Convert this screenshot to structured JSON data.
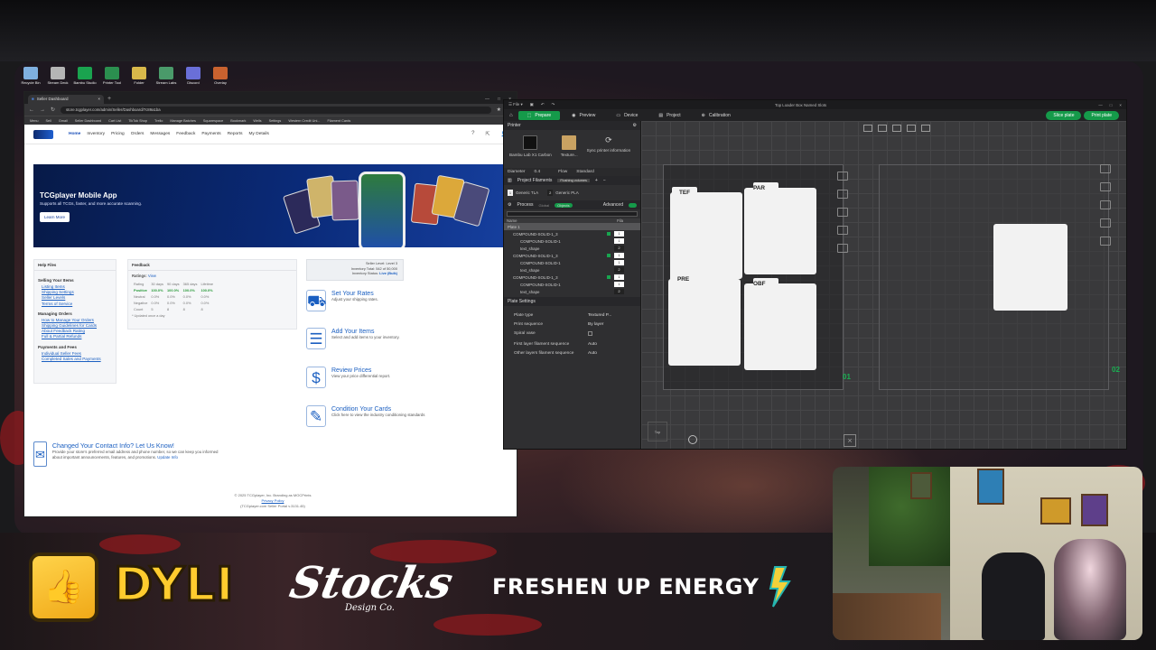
{
  "desktop_icons": [
    "Recycle Bin",
    "Stream Deck",
    "Bambu Studio",
    "Printer Tool",
    "Folder",
    "Stream Labs",
    "Discord",
    "Overlay"
  ],
  "browser": {
    "tab_title": "Seller Dashboard",
    "url": "store.tcgplayer.com/admin/Seller/Dashboard/7c89a1ba",
    "bookmarks": [
      "Menu",
      "Sell",
      "Gmail",
      "Seller Dashboard",
      "Cart List",
      "TikTok Shop",
      "Trello",
      "Manage Batches",
      "Squarespace",
      "Bookmark",
      "Wells",
      "Settings",
      "Western Credit Uni...",
      "Filament Cards"
    ]
  },
  "tcg": {
    "nav": [
      "Home",
      "Inventory",
      "Pricing",
      "Orders",
      "Messages",
      "Feedback",
      "Payments",
      "Reports",
      "My Details"
    ],
    "hero": {
      "title": "TCGplayer Mobile App",
      "subtitle": "Supports all TCGs, faster, and more accurate scanning.",
      "button": "Learn More"
    },
    "help": {
      "title": "Help Files",
      "groups": [
        {
          "header": "Selling Your Items",
          "links": [
            "Listing Items",
            "Shipping Settings",
            "Seller Levels",
            "Terms of Service"
          ]
        },
        {
          "header": "Managing Orders",
          "links": [
            "How to Manage Your Orders",
            "Shipping Guidelines for Cards",
            "About Feedback Rating",
            "Full & Partial Refunds"
          ]
        },
        {
          "header": "Payments and Fees",
          "links": [
            "Individual Seller Fees",
            "Completed Sales and Payments"
          ]
        }
      ]
    },
    "feedback": {
      "title": "Feedback",
      "ratings_label": "Ratings:",
      "ratings_link": "View",
      "header_row": [
        "Rating",
        "30 days",
        "90 days",
        "365 days",
        "Lifetime"
      ],
      "rows": [
        {
          "label": "Positive",
          "values": [
            "100.0%",
            "100.0%",
            "100.0%",
            "100.0%"
          ]
        },
        {
          "label": "Neutral",
          "values": [
            "0.0%",
            "0.0%",
            "0.0%",
            "0.0%"
          ]
        },
        {
          "label": "Negative",
          "values": [
            "0.0%",
            "0.0%",
            "0.0%",
            "0.0%"
          ]
        },
        {
          "label": "Count",
          "values": [
            "5",
            "8",
            "8",
            "8"
          ]
        }
      ],
      "note": "* Updated once a day"
    },
    "seller": {
      "level": "Seller Level:  Level 3",
      "inventory": "Inventory Total:  542 of 50,000",
      "status_label": "Inventory Status:",
      "status_value": "Live (Bulk)"
    },
    "actions": [
      {
        "title": "Set Your Rates",
        "desc": "Adjust your shipping rates.",
        "icon": "truck-icon"
      },
      {
        "title": "Add Your Items",
        "desc": "Select and add items to your inventory.",
        "icon": "list-icon"
      },
      {
        "title": "Review Prices",
        "desc": "View your price differential report.",
        "icon": "price-icon"
      },
      {
        "title": "Condition Your Cards",
        "desc": "Click here to view the industry conditioning standards",
        "icon": "tag-icon"
      }
    ],
    "contact": {
      "title": "Changed Your Contact Info? Let Us Know!",
      "text": "Provide your store's preferred email address and phone number, so we can keep you informed about important announcements, features, and promotions.",
      "link": "Update Info"
    },
    "footer": {
      "copyright": "© 2025 TCGplayer, Inc. Branding as MOCPrints",
      "privacy": "Privacy Policy",
      "seller_id": "(TCGplayer.com Seller Portal v.3131.45)"
    }
  },
  "bambu": {
    "window_title": "Top Loader Box Named Slots",
    "tabs": [
      "Prepare",
      "Preview",
      "Device",
      "Project",
      "Calibration"
    ],
    "slice_button": "Slice plate",
    "print_button": "Print plate",
    "printer_section": "Printer",
    "printer_name": "Bambu Lab X1 Carbon",
    "plate_texture": "Texture...",
    "sync_label": "Sync printer information",
    "diameter_label": "Diameter",
    "diameter_value": "0.4",
    "flow_label": "Flow",
    "flow_value": "Standard",
    "filaments_section": "Project Filaments",
    "filaments_badge": "Flushing volumes",
    "filaments": [
      {
        "slot": "1",
        "name": "Generic TLA"
      },
      {
        "slot": "2",
        "name": "Generic PLA"
      }
    ],
    "process_section": "Process",
    "process_global": "Global",
    "process_objects": "Objects",
    "advanced_label": "Advanced",
    "objects_col_name": "Name",
    "objects_col_fila": "Fila",
    "objects": [
      {
        "label": "Plate 1",
        "kind": "plate"
      },
      {
        "label": "COMPOUND-SOLID-1_3",
        "kind": "object",
        "num": "1"
      },
      {
        "label": "COMPOUND-SOLID-1",
        "kind": "sub",
        "num": "1"
      },
      {
        "label": "text_shape",
        "kind": "sub",
        "num": "2"
      },
      {
        "label": "COMPOUND-SOLID-1_3",
        "kind": "object",
        "num": "1"
      },
      {
        "label": "COMPOUND-SOLID-1",
        "kind": "sub",
        "num": "1"
      },
      {
        "label": "text_shape",
        "kind": "sub",
        "num": "2"
      },
      {
        "label": "COMPOUND-SOLID-1_3",
        "kind": "object",
        "num": "1"
      },
      {
        "label": "COMPOUND-SOLID-1",
        "kind": "sub",
        "num": "1"
      },
      {
        "label": "text_shape",
        "kind": "sub",
        "num": "2"
      }
    ],
    "plate_settings_title": "Plate Settings",
    "plate_settings": [
      {
        "label": "Plate type",
        "value": "Textured P..."
      },
      {
        "label": "Print sequence",
        "value": "By layer"
      },
      {
        "label": "Spiral vase",
        "value": ""
      },
      {
        "label": "First layer filament sequence",
        "value": "Auto"
      },
      {
        "label": "Other layers filament sequence",
        "value": "Auto"
      }
    ],
    "tiles": [
      "TEF",
      "PAR",
      "PRE",
      "OBF"
    ],
    "plate_numbers": [
      "01",
      "02"
    ],
    "view_cube_label": "Top"
  },
  "sponsors": {
    "dyli": "DYLI",
    "stocks": "Stocks",
    "stocks_sub": "Design Co.",
    "freshen": "FRESHEN UP ENERGY"
  },
  "colors": {
    "tcg_blue": "#1b5fc1",
    "bambu_green": "#159a4a",
    "dyli_yellow": "#ffcc2e"
  }
}
